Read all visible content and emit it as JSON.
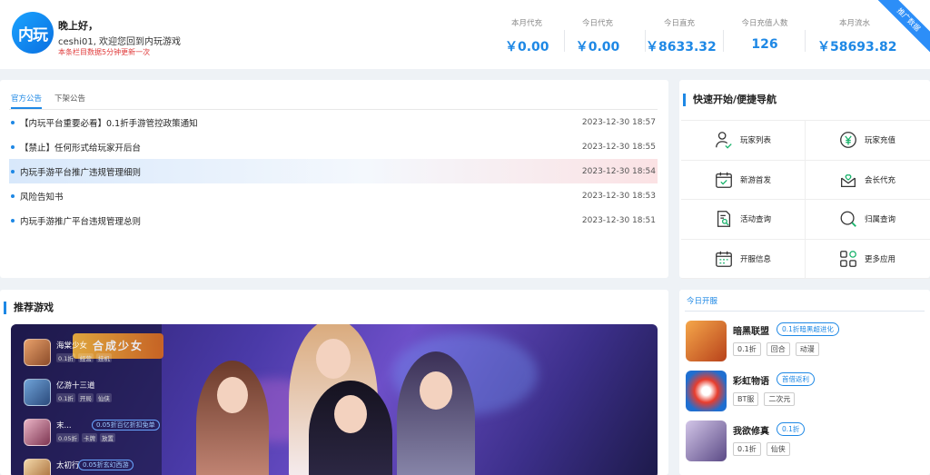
{
  "header": {
    "logo_text": "内玩",
    "greeting": "晚上好，",
    "welcome": "ceshi01, 欢迎您回到内玩游戏",
    "notice": "本条栏目数据5分钟更新一次",
    "ribbon": "推广数据",
    "stats": [
      {
        "label": "本月代充",
        "value": "￥0.00"
      },
      {
        "label": "今日代充",
        "value": "￥0.00"
      },
      {
        "label": "今日直充",
        "value": "￥8633.32"
      },
      {
        "label": "今日充值人数",
        "value": "126"
      },
      {
        "label": "本月流水",
        "value": "￥58693.82"
      }
    ]
  },
  "announcements": {
    "tabs": [
      "官方公告",
      "下架公告"
    ],
    "items": [
      {
        "title": "【内玩平台重要必看】0.1折手游管控政策通知",
        "date": "2023-12-30 18:57"
      },
      {
        "title": "【禁止】任何形式给玩家开后台",
        "date": "2023-12-30 18:55"
      },
      {
        "title": "内玩手游平台推广违规管理细则",
        "date": "2023-12-30 18:54"
      },
      {
        "title": "风险告知书",
        "date": "2023-12-30 18:53"
      },
      {
        "title": "内玩手游推广平台违规管理总则",
        "date": "2023-12-30 18:51"
      }
    ]
  },
  "quick": {
    "title": "快速开始/便捷导航",
    "items": [
      {
        "label": "玩家列表",
        "icon": "user-check-icon"
      },
      {
        "label": "玩家充值",
        "icon": "yuan-coin-icon"
      },
      {
        "label": "新游首发",
        "icon": "calendar-check-icon"
      },
      {
        "label": "会长代充",
        "icon": "heart-tray-icon"
      },
      {
        "label": "活动查询",
        "icon": "document-search-icon"
      },
      {
        "label": "归属查询",
        "icon": "search-icon"
      },
      {
        "label": "开服信息",
        "icon": "calendar-icon"
      },
      {
        "label": "更多应用",
        "icon": "apps-grid-icon"
      }
    ]
  },
  "recommend": {
    "title": "推荐游戏",
    "banner_logo": "合成少女",
    "games": [
      {
        "name": "海棠少女",
        "tag": "",
        "subs": [
          "0.1折",
          "经营",
          "挂机"
        ]
      },
      {
        "name": "亿游十三道",
        "tag": "",
        "subs": [
          "0.1折",
          "开局",
          "仙侠"
        ]
      },
      {
        "name": "末...",
        "tag": "0.05折百亿折扣免单",
        "subs": [
          "0.05折",
          "卡牌",
          "放置"
        ]
      },
      {
        "name": "太初行",
        "tag": "0.05折玄幻西游",
        "subs": []
      }
    ]
  },
  "today": {
    "tab": "今日开服",
    "items": [
      {
        "name": "暗黑联盟",
        "tag": "0.1折暗黑超进化",
        "subs": [
          "0.1折",
          "回合",
          "动漫"
        ]
      },
      {
        "name": "彩虹物语",
        "tag": "首借返利",
        "subs": [
          "BT服",
          "二次元"
        ]
      },
      {
        "name": "我欲修真",
        "tag": "0.1折",
        "subs": [
          "0.1折",
          "仙侠"
        ]
      }
    ]
  },
  "colors": {
    "accent": "#1e88e5",
    "notice": "#e03a3a"
  }
}
